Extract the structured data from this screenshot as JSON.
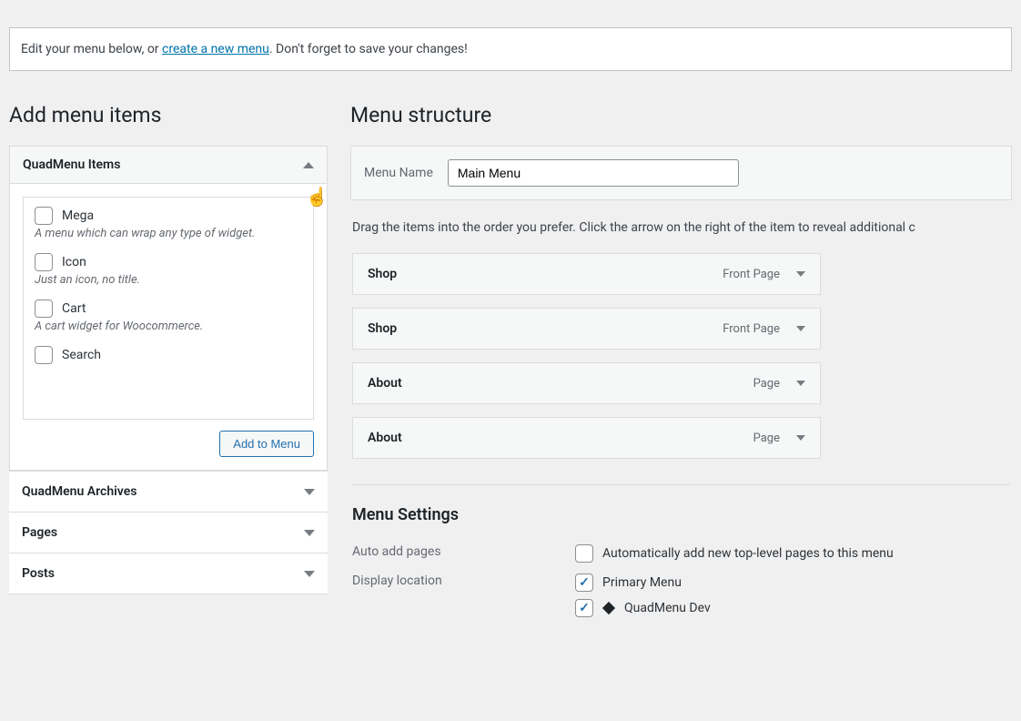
{
  "notice": {
    "prefix": "Edit your menu below, or ",
    "link": "create a new menu",
    "suffix": ". Don't forget to save your changes!"
  },
  "left": {
    "title": "Add menu items",
    "panel1": {
      "header": "QuadMenu Items",
      "items": [
        {
          "label": "Mega",
          "desc": "A menu which can wrap any type of widget."
        },
        {
          "label": "Icon",
          "desc": "Just an icon, no title."
        },
        {
          "label": "Cart",
          "desc": "A cart widget for Woocommerce."
        },
        {
          "label": "Search",
          "desc": ""
        }
      ],
      "add_button": "Add to Menu"
    },
    "panel2": "QuadMenu Archives",
    "panel3": "Pages",
    "panel4": "Posts"
  },
  "right": {
    "title": "Menu structure",
    "menu_name_label": "Menu Name",
    "menu_name_value": "Main Menu",
    "instructions": "Drag the items into the order you prefer. Click the arrow on the right of the item to reveal additional c",
    "menu_items": [
      {
        "title": "Shop",
        "type": "Front Page"
      },
      {
        "title": "Shop",
        "type": "Front Page"
      },
      {
        "title": "About",
        "type": "Page"
      },
      {
        "title": "About",
        "type": "Page"
      }
    ],
    "settings": {
      "title": "Menu Settings",
      "auto_add_label": "Auto add pages",
      "auto_add_text": "Automatically add new top-level pages to this menu",
      "display_label": "Display location",
      "loc1": "Primary Menu",
      "loc2": "QuadMenu Dev"
    }
  }
}
